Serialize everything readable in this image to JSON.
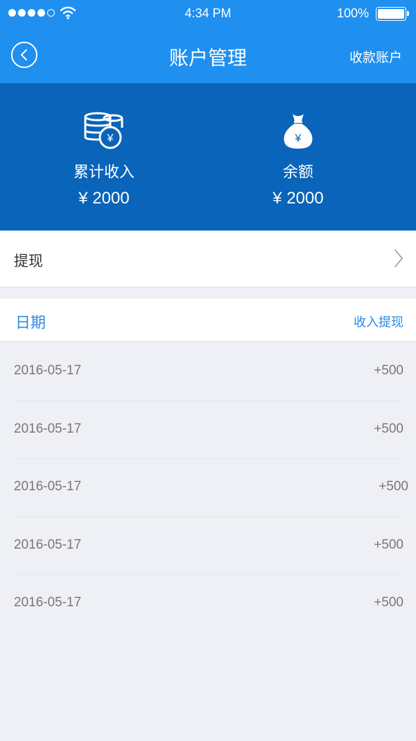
{
  "status_bar": {
    "time": "4:34 PM",
    "battery": "100%",
    "signal_strength": 4
  },
  "nav": {
    "back_icon": "chevron-left-circle-icon",
    "title": "账户管理",
    "right_action": "收款账户"
  },
  "summary": {
    "total_income_label": "累计收入",
    "total_income_value": "¥ 2000",
    "total_income_icon": "coin-stack-icon",
    "balance_label": "余额",
    "balance_value": "¥ 2000",
    "balance_icon": "money-bag-icon"
  },
  "withdraw": {
    "label": "提现"
  },
  "list": {
    "header_left": "日期",
    "header_right": "收入提现",
    "rows": [
      {
        "date": "2016-05-17",
        "amount": "+500"
      },
      {
        "date": "2016-05-17",
        "amount": "+500"
      },
      {
        "date": "2016-05-17",
        "amount": "+500"
      },
      {
        "date": "2016-05-17",
        "amount": "+500"
      },
      {
        "date": "2016-05-17",
        "amount": "+500"
      }
    ]
  },
  "colors": {
    "nav_bg": "#1f8ff0",
    "hero_bg": "#0a64b9",
    "accent": "#2a8ae6",
    "page_bg": "#eff0f5"
  }
}
